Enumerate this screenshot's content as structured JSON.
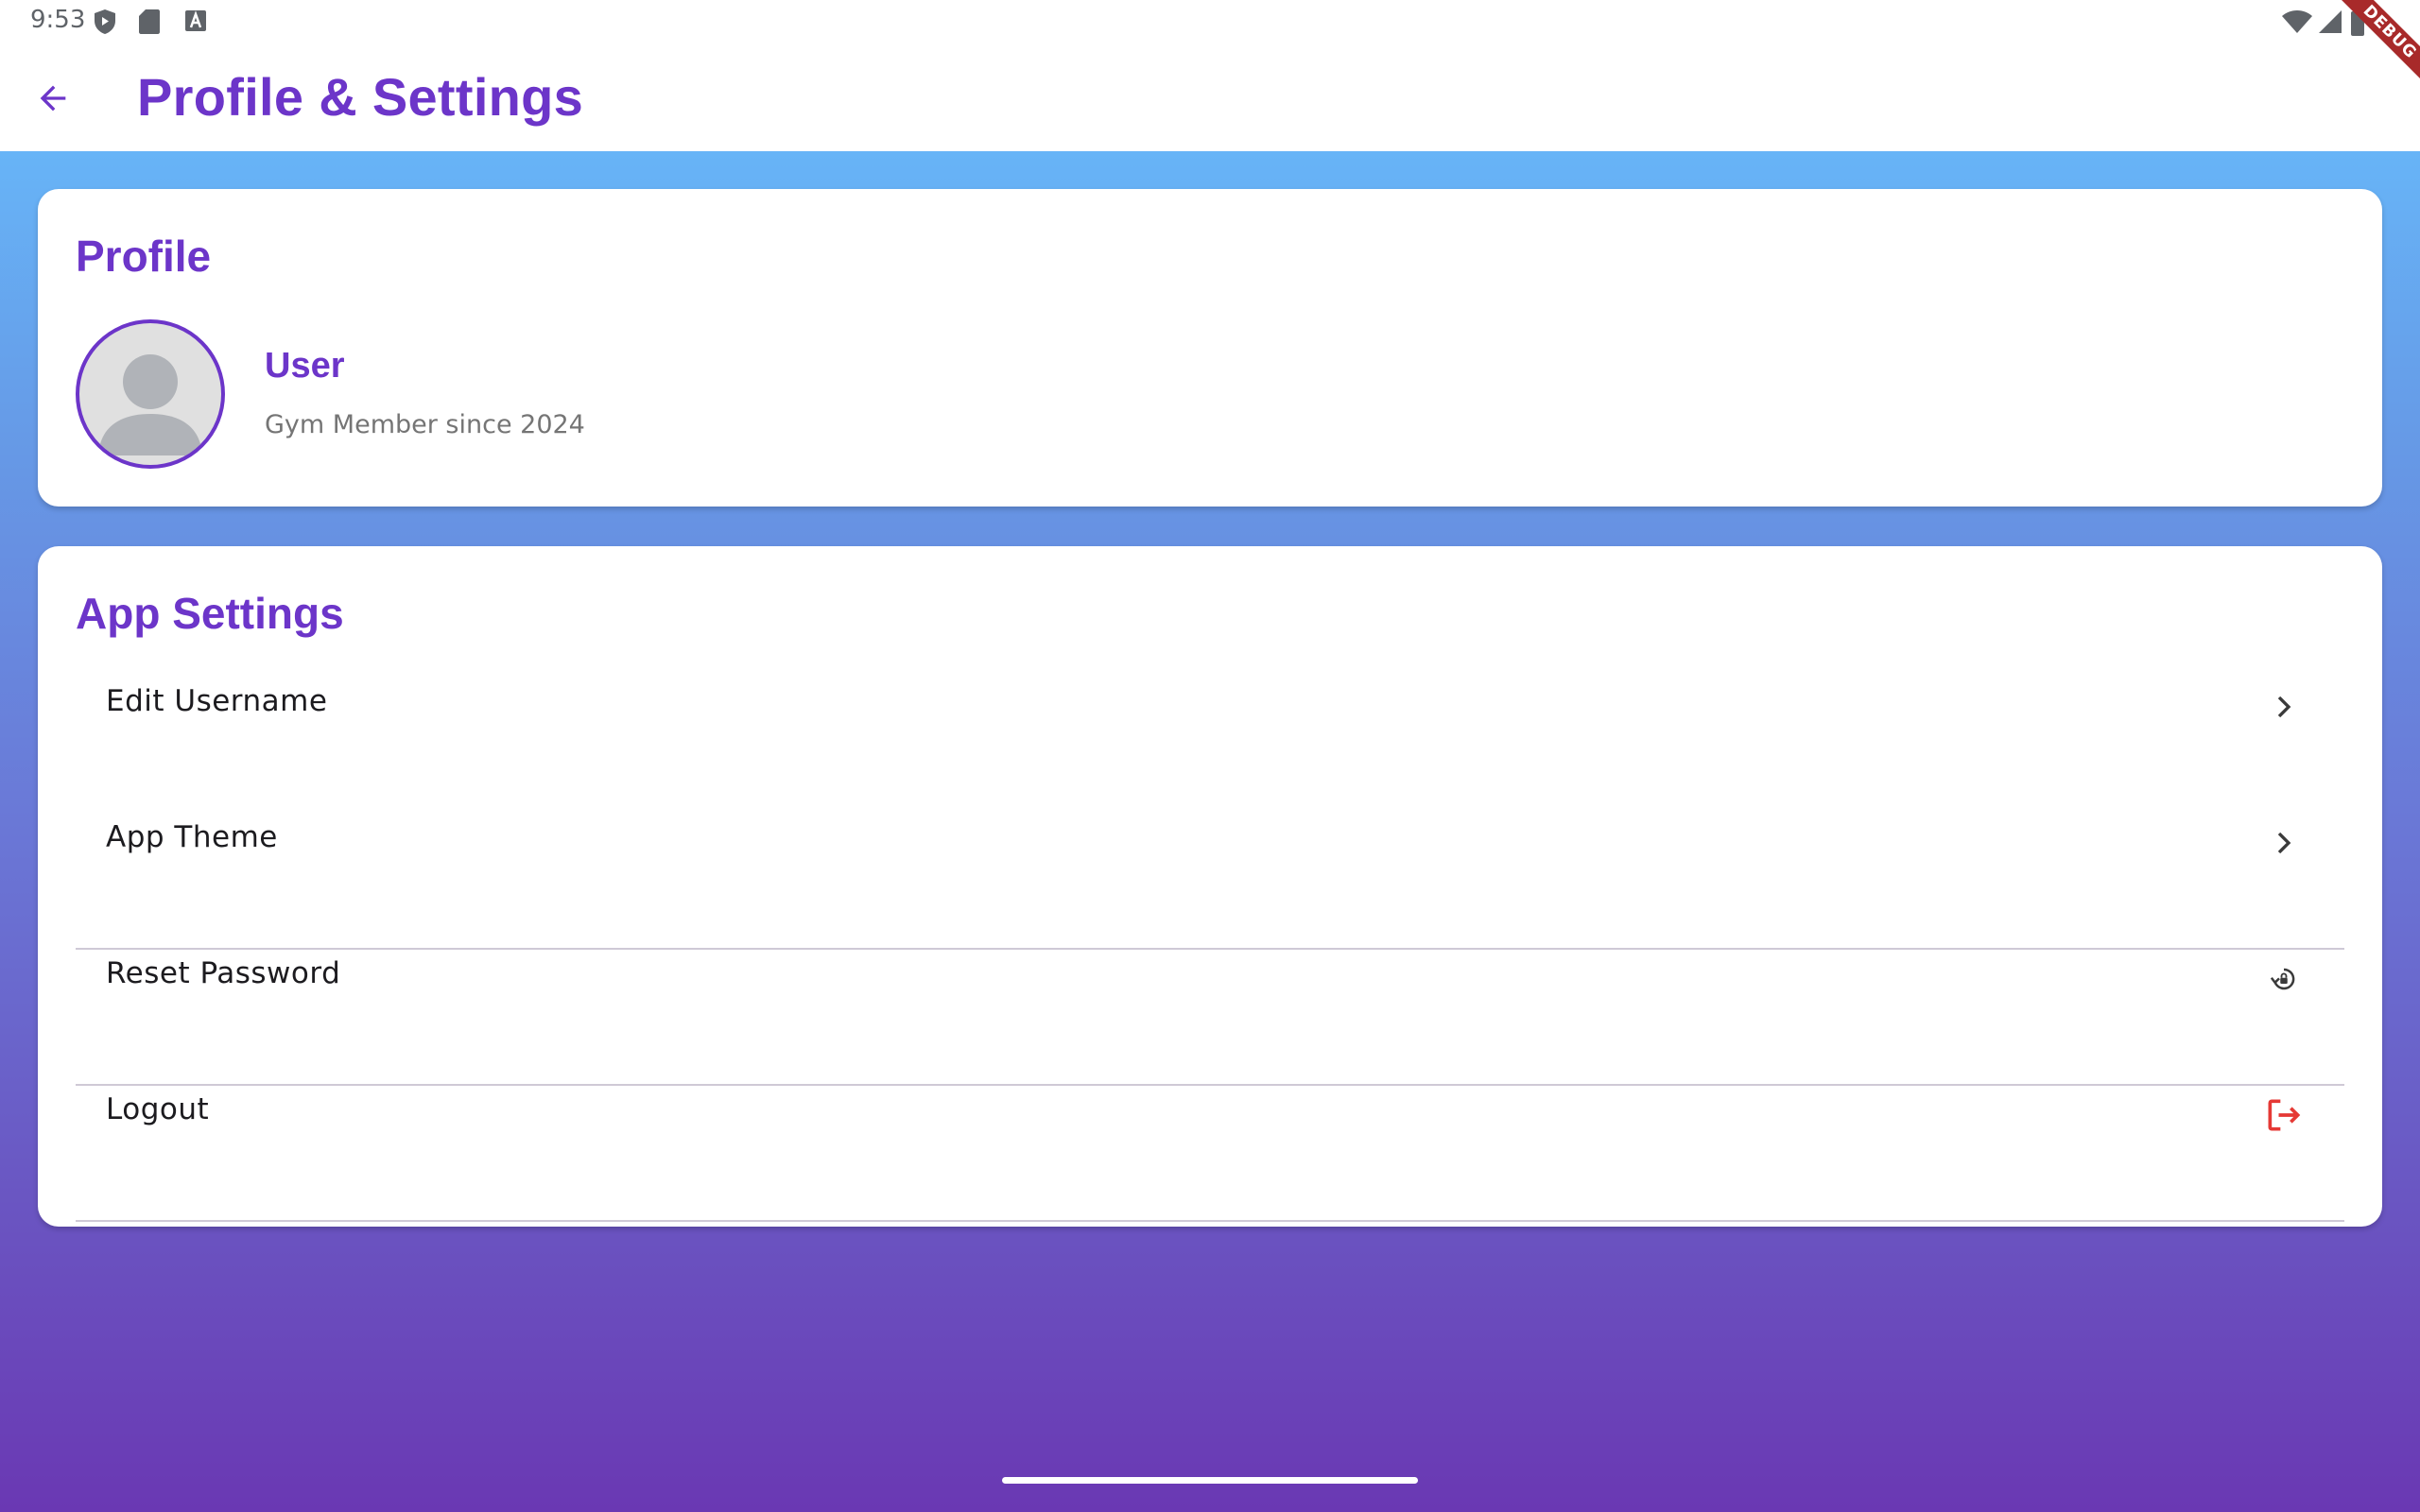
{
  "status_bar": {
    "time": "9:53",
    "icons": [
      "shield-icon",
      "sd-card-icon",
      "font-a-icon",
      "wifi-icon",
      "cellular-signal-icon",
      "battery-icon"
    ]
  },
  "app_bar": {
    "title": "Profile & Settings",
    "back_icon": "arrow-back-icon"
  },
  "debug_banner": "DEBUG",
  "profile": {
    "section_title": "Profile",
    "user_name": "User",
    "member_since": "Gym Member since 2024"
  },
  "settings": {
    "section_title": "App Settings",
    "items": [
      {
        "label": "Edit Username",
        "icon": "chevron-right-icon"
      },
      {
        "label": "App Theme",
        "icon": "chevron-right-icon"
      },
      {
        "label": "Reset Password",
        "icon": "lock-reset-icon"
      },
      {
        "label": "Logout",
        "icon": "logout-icon"
      }
    ]
  },
  "colors": {
    "accent": "#6c35c9",
    "gradient_top": "#67b4f7",
    "gradient_bottom": "#6a38b3",
    "logout_icon": "#e53935"
  }
}
